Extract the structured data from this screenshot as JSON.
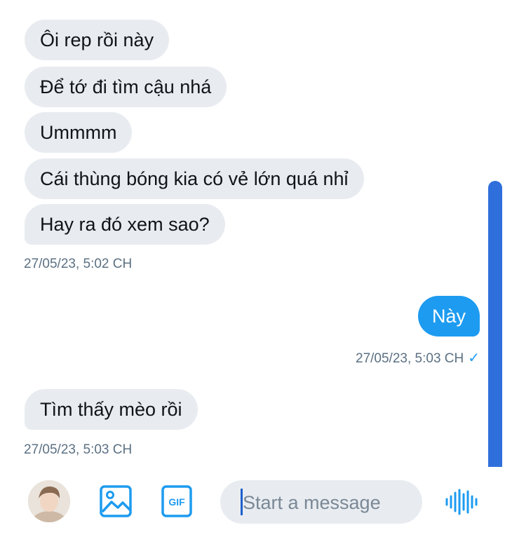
{
  "messages_incoming_1": [
    {
      "text": "Ôi rep rồi này"
    },
    {
      "text": "Để tớ đi tìm cậu nhá"
    },
    {
      "text": "Ummmm"
    },
    {
      "text": "Cái thùng bóng kia có vẻ lớn quá nhỉ"
    },
    {
      "text": "Hay ra đó xem sao?"
    }
  ],
  "timestamp_1": "27/05/23, 5:02 CH",
  "message_outgoing": {
    "text": "Này"
  },
  "timestamp_2": "27/05/23, 5:03 CH",
  "message_incoming_2": {
    "text": "Tìm thấy mèo rồi"
  },
  "timestamp_3": "27/05/23, 5:03 CH",
  "composer": {
    "placeholder": "Start a message",
    "icons": [
      "avatar",
      "image-icon",
      "gif-icon",
      "voice-icon"
    ]
  },
  "colors": {
    "accent": "#1d9bf0",
    "bubble_gray": "#e8ecf0",
    "scrollbar": "#2f6fdc"
  }
}
